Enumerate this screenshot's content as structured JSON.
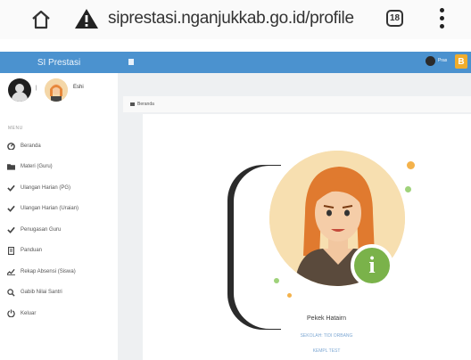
{
  "browser": {
    "url": "siprestasi.nganjukkab.go.id/profile",
    "tab_count": "18"
  },
  "app": {
    "brand": "SI Prestasi",
    "top_user": "Pras",
    "top_badge": "B"
  },
  "sidebar": {
    "user_name": "Eshi",
    "separator": "|",
    "menu_header": "MENU",
    "items": [
      {
        "label": "Beranda",
        "icon": "dashboard-icon"
      },
      {
        "label": "Materi (Guru)",
        "icon": "folder-icon"
      },
      {
        "label": "Ulangan Harian (PG)",
        "icon": "check-icon"
      },
      {
        "label": "Ulangan Harian (Uraian)",
        "icon": "check-icon"
      },
      {
        "label": "Penugasan Guru",
        "icon": "check-icon"
      },
      {
        "label": "Panduan",
        "icon": "document-icon"
      },
      {
        "label": "Rekap Absensi (Siswa)",
        "icon": "chart-icon"
      },
      {
        "label": "Gabib Nilai Santri",
        "icon": "search-icon"
      },
      {
        "label": "Keluar",
        "icon": "power-icon"
      }
    ]
  },
  "content": {
    "breadcrumb": "Beranda",
    "profile_name": "Pekek Hatairn",
    "profile_line1": "SEKOLAH: TIDI ORBANG",
    "profile_line2": "KEMPL TEST"
  },
  "colors": {
    "topbar": "#4b92cf",
    "badge": "#f0ad2c",
    "info_badge": "#7ab24a"
  }
}
